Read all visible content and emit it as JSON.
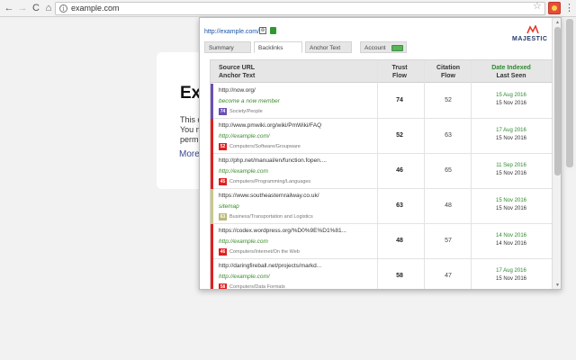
{
  "browser": {
    "url": "example.com",
    "back_glyph": "←",
    "forward_glyph": "→",
    "reload_glyph": "C",
    "home_glyph": "⌂",
    "info_glyph": "i",
    "star_glyph": "☆",
    "menu_glyph": "⋮",
    "icons": [
      "back-icon",
      "forward-icon",
      "reload-icon",
      "home-icon",
      "info-icon",
      "star-icon",
      "majestic-extension-icon",
      "menu-icon"
    ]
  },
  "page": {
    "title_visible": "Exa",
    "lines": [
      "This d",
      "You m",
      "permi"
    ],
    "more_link": "More"
  },
  "popup": {
    "site_url": "http://example.com/",
    "logo_text": "MAJESTIC",
    "small_icon_glyph": "⊕",
    "tabs": [
      {
        "label": "Summary",
        "active": false
      },
      {
        "label": "Backlinks",
        "active": true
      },
      {
        "label": "Anchor Text",
        "active": false
      },
      {
        "label": "Account",
        "active": false
      }
    ],
    "table": {
      "headers": {
        "source_url": "Source URL",
        "anchor_text": "Anchor Text",
        "trust": "Trust",
        "trust2": "Flow",
        "citation": "Citation",
        "citation2": "Flow",
        "date_indexed": "Date Indexed",
        "last_seen": "Last Seen"
      },
      "rows": [
        {
          "url": "http://now.org/",
          "anchor": "become a now member",
          "badge": "74",
          "badge_color": "#6b4fb5",
          "stripe_color": "#6b4fb5",
          "category": "Society/People",
          "trust_flow": "74",
          "citation_flow": "52",
          "date_indexed": "15 Aug 2016",
          "last_seen": "15 Nov 2016"
        },
        {
          "url": "http://www.pmwiki.org/wiki/PmWiki/FAQ",
          "anchor": "http://example.com/",
          "badge": "52",
          "badge_color": "#e02020",
          "stripe_color": "#e02020",
          "category": "Computers/Software/Groupware",
          "trust_flow": "52",
          "citation_flow": "63",
          "date_indexed": "17 Aug 2016",
          "last_seen": "15 Nov 2016"
        },
        {
          "url": "http://php.net/manual/en/function.fopen....",
          "anchor": "http://example.com",
          "badge": "45",
          "badge_color": "#e02020",
          "stripe_color": "#e02020",
          "category": "Computers/Programming/Languages",
          "trust_flow": "46",
          "citation_flow": "65",
          "date_indexed": "11 Sep 2016",
          "last_seen": "15 Nov 2016"
        },
        {
          "url": "https://www.southeasternrailway.co.uk/",
          "anchor": "sitemap",
          "badge": "63",
          "badge_color": "#b9b97a",
          "stripe_color": "#c8c88a",
          "category": "Business/Transportation and Logistics",
          "trust_flow": "63",
          "citation_flow": "48",
          "date_indexed": "15 Nov 2016",
          "last_seen": "15 Nov 2016"
        },
        {
          "url": "https://codex.wordpress.org/%D0%9E%D1%81...",
          "anchor": "http://example.com",
          "badge": "46",
          "badge_color": "#e02020",
          "stripe_color": "#e02020",
          "category": "Computers/Internet/On the Web",
          "trust_flow": "48",
          "citation_flow": "57",
          "date_indexed": "14 Nov 2016",
          "last_seen": "14 Nov 2016"
        },
        {
          "url": "http://daringfireball.net/projects/markd...",
          "anchor": "http://example.com/",
          "badge": "58",
          "badge_color": "#e02020",
          "stripe_color": "#e02020",
          "category": "Computers/Data Formats",
          "trust_flow": "58",
          "citation_flow": "47",
          "date_indexed": "17 Aug 2016",
          "last_seen": "15 Nov 2016"
        }
      ]
    }
  }
}
